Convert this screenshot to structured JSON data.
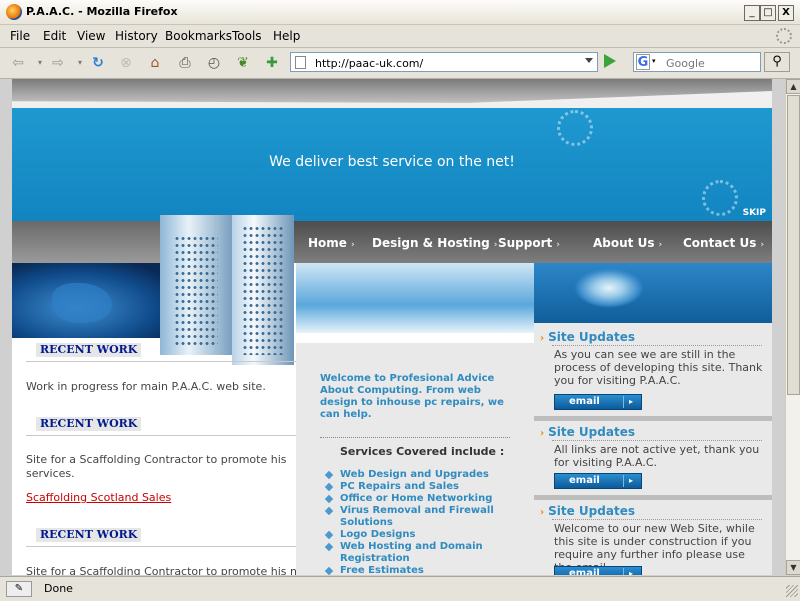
{
  "window": {
    "title": "P.A.A.C. - Mozilla Firefox",
    "buttons": [
      "_",
      "□",
      "X"
    ]
  },
  "menu": [
    "File",
    "Edit",
    "View",
    "History",
    "Bookmarks",
    "Tools",
    "Help"
  ],
  "toolbar": {
    "url": "http://paac-uk.com/",
    "search_placeholder": "Google",
    "search_engine_letter": "G"
  },
  "site": {
    "tagline": "We deliver best service on the net!",
    "skip": "SKIP",
    "nav": [
      "Home",
      "Design & Hosting",
      "Support",
      "About Us",
      "Contact Us"
    ],
    "left": {
      "sections": [
        {
          "heading": "RECENT WORK",
          "text": "Work in progress for main P.A.A.C. web site."
        },
        {
          "heading": "RECENT WORK",
          "text": "Site for a Scaffolding Contractor to promote his services.",
          "link": "Scaffolding Scotland Sales"
        },
        {
          "heading": "RECENT WORK",
          "text": "Site for a Scaffolding Contractor to promote his new"
        }
      ]
    },
    "middle": {
      "intro": "Welcome to Profesional Advice About Computing. From web design to inhouse pc repairs, we can help.",
      "services_title": "Services Covered include :",
      "services": [
        "Web Design and Upgrades",
        "PC Repairs and Sales",
        "Office or Home Networking",
        "Virus Removal and Firewall Solutions",
        "Logo Designs",
        "Web Hosting and Domain Registration",
        "Free Estimates"
      ]
    },
    "right": {
      "updates": [
        {
          "title": "Site Updates",
          "text": "As you can see we are still in the process of developing this site. Thank you for visiting P.A.A.C.",
          "button": "email"
        },
        {
          "title": "Site Updates",
          "text": "All links are not active yet, thank you for visiting P.A.A.C.",
          "button": "email"
        },
        {
          "title": "Site Updates",
          "text": "Welcome to our new Web Site, while this site is under construction if you require any further info please use the email.",
          "button": "email"
        }
      ]
    }
  },
  "status": {
    "text": "Done"
  }
}
